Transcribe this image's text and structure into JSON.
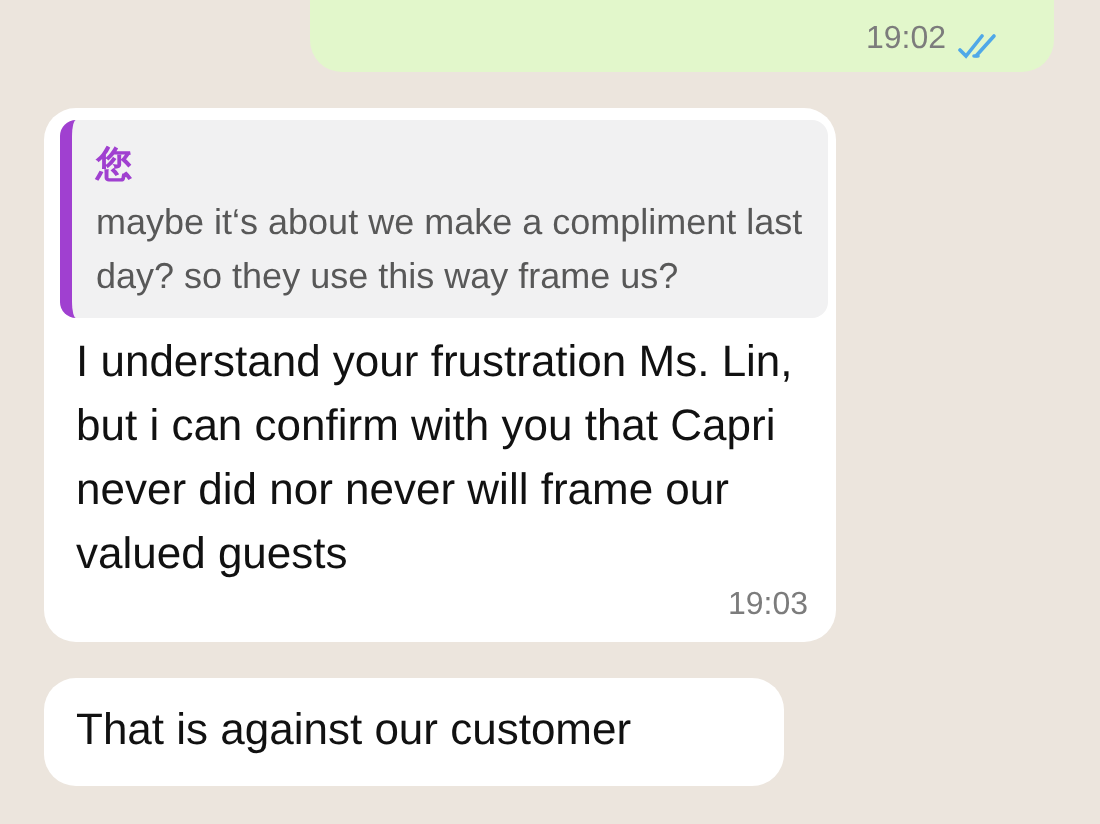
{
  "messages": [
    {
      "kind": "outgoing",
      "time": "19:02",
      "read": true
    },
    {
      "kind": "incoming",
      "quote": {
        "sender": "您",
        "text": "maybe it‘s about we make a compliment last day?  so they use this way frame us?"
      },
      "text": "I understand your frustration Ms. Lin, but i can confirm with you that Capri never did nor never will frame our valued guests",
      "time": "19:03"
    },
    {
      "kind": "incoming",
      "text": "That is against our customer"
    }
  ]
}
